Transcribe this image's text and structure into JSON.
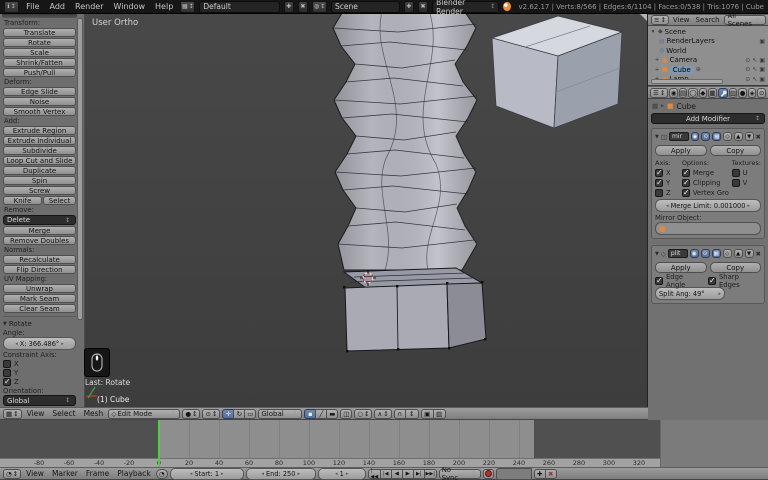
{
  "topbar": {
    "menus": [
      "File",
      "Add",
      "Render",
      "Window",
      "Help"
    ],
    "layout_value": "Default",
    "scene_value": "Scene",
    "engine_value": "Blender Render",
    "stats": "v2.62.17 | Verts:8/566 | Edges:6/1104 | Faces:0/538 | Tris:1076 | Cube"
  },
  "viewport": {
    "view_label": "User Ortho",
    "last_action": "Last: Rotate",
    "active_object": "(1) Cube"
  },
  "toolshelf": {
    "sections": [
      {
        "label": "Transform:",
        "buttons": [
          "Translate",
          "Rotate",
          "Scale",
          "Shrink/Fatten",
          "Push/Pull"
        ]
      },
      {
        "label": "Deform:",
        "buttons": [
          "Edge Slide",
          "Noise",
          "Smooth Vertex"
        ]
      },
      {
        "label": "Add:",
        "buttons": [
          "Extrude Region",
          "Extrude Individual",
          "Subdivide",
          "Loop Cut and Slide",
          "Duplicate",
          "Spin",
          "Screw"
        ]
      }
    ],
    "knife_label": "Knife",
    "select_label": "Select",
    "remove_label": "Remove:",
    "delete_label": "Delete",
    "merge_label": "Merge",
    "remove_doubles_label": "Remove Doubles",
    "normals_label": "Normals:",
    "recalculate_label": "Recalculate",
    "flip_label": "Flip Direction",
    "uv_label": "UV Mapping:",
    "unwrap_label": "Unwrap",
    "mark_seam_label": "Mark Seam",
    "clear_seam_label": "Clear Seam"
  },
  "operator_panel": {
    "title": "Rotate",
    "angle_label": "Angle:",
    "angle_value": "X: 366.486°",
    "constraint_label": "Constraint Axis:",
    "axes": [
      {
        "label": "X",
        "checked": false
      },
      {
        "label": "Y",
        "checked": false
      },
      {
        "label": "Z",
        "checked": true
      }
    ],
    "orientation_label": "Orientation:",
    "orientation_value": "Global"
  },
  "view3d_header": {
    "menus": [
      "View",
      "Select",
      "Mesh"
    ],
    "mode_value": "Edit Mode",
    "orientation_value": "Global"
  },
  "outliner": {
    "menus": [
      "View",
      "Search"
    ],
    "filter_value": "All Scenes",
    "items": [
      {
        "label": "Scene"
      },
      {
        "label": "RenderLayers"
      },
      {
        "label": "World"
      },
      {
        "label": "Camera"
      },
      {
        "label": "Cube"
      },
      {
        "label": "Lamp"
      }
    ]
  },
  "properties": {
    "breadcrumb_object": "Cube",
    "add_modifier_label": "Add Modifier",
    "mirror": {
      "name": "mir",
      "apply_label": "Apply",
      "copy_label": "Copy",
      "axis_label": "Axis:",
      "options_label": "Options:",
      "textures_label": "Textures:",
      "axis": [
        {
          "label": "X",
          "checked": true
        },
        {
          "label": "Y",
          "checked": true
        },
        {
          "label": "Z",
          "checked": false
        }
      ],
      "options": [
        {
          "label": "Merge",
          "checked": true
        },
        {
          "label": "Clipping",
          "checked": true
        },
        {
          "label": "Vertex Gro",
          "checked": true
        }
      ],
      "textures": [
        {
          "label": "U",
          "checked": false
        },
        {
          "label": "V",
          "checked": false
        }
      ],
      "merge_limit_value": "Merge Limit: 0.001000",
      "mirror_object_label": "Mirror Object:"
    },
    "edge_split": {
      "name": "plit",
      "apply_label": "Apply",
      "copy_label": "Copy",
      "edge_angle": {
        "label": "Edge Angle",
        "checked": true
      },
      "sharp_edges": {
        "label": "Sharp Edges",
        "checked": true
      },
      "split_angle_value": "Split Ang: 49°"
    }
  },
  "timeline": {
    "menus": [
      "View",
      "Marker",
      "Frame",
      "Playback"
    ],
    "start_value": "Start: 1",
    "end_value": "End: 250",
    "current_frame": "1",
    "sync_value": "No Sync",
    "ruler": [
      "-80",
      "-60",
      "-40",
      "-20",
      "0",
      "20",
      "40",
      "60",
      "80",
      "100",
      "120",
      "140",
      "160",
      "180",
      "200",
      "220",
      "240",
      "260",
      "280",
      "300",
      "320"
    ]
  },
  "colors": {
    "accent_blue": "#5680c2",
    "object_orange": "#e0883c",
    "playhead_green": "#54ca47",
    "record_red": "#b23030"
  }
}
